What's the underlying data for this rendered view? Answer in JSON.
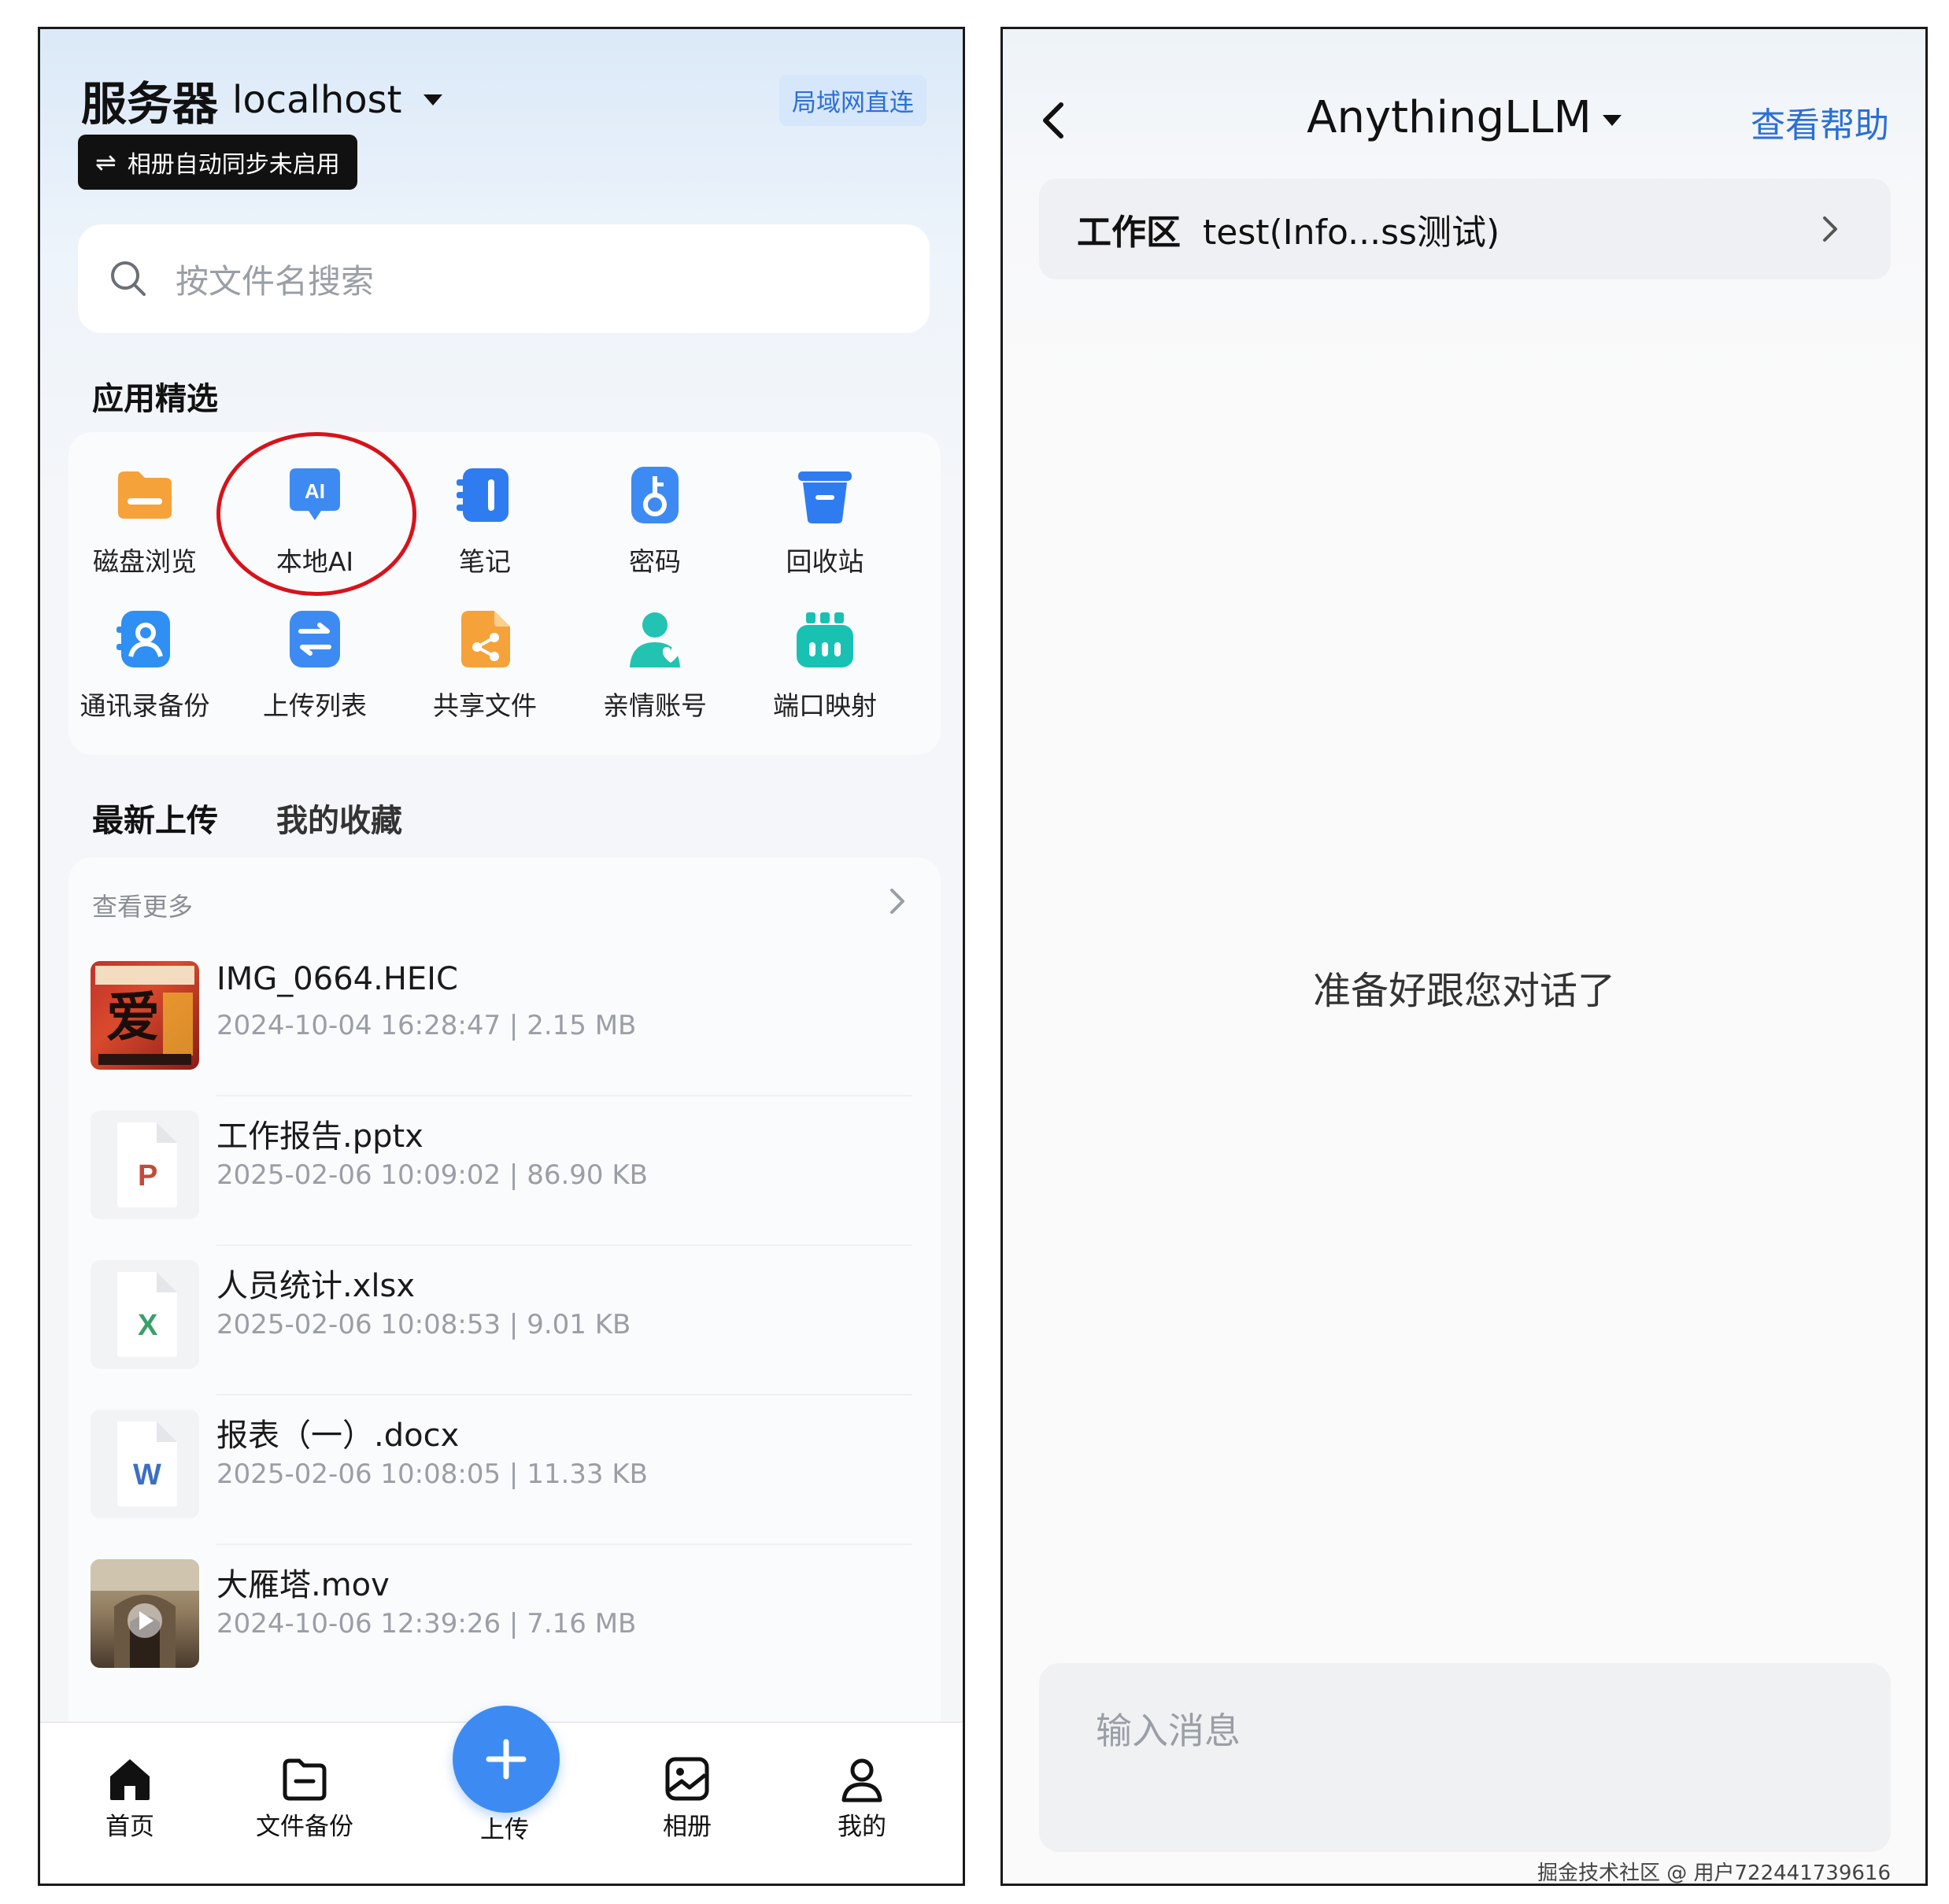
{
  "left": {
    "server_label": "服务器",
    "server_host": "localhost",
    "lan_badge": "局域网直连",
    "sync_icon": "⇌",
    "sync_text": "相册自动同步未启用",
    "search_placeholder": "按文件名搜索",
    "featured_title": "应用精选",
    "apps": [
      {
        "label": "磁盘浏览",
        "icon": "folder-icon",
        "color": "#f6a23a"
      },
      {
        "label": "本地AI",
        "icon": "ai-chat-icon",
        "color": "#3d8bf2"
      },
      {
        "label": "笔记",
        "icon": "notebook-icon",
        "color": "#2f7cf0"
      },
      {
        "label": "密码",
        "icon": "key-icon",
        "color": "#3d8bf2"
      },
      {
        "label": "回收站",
        "icon": "trash-icon",
        "color": "#2f7cf0"
      },
      {
        "label": "通讯录备份",
        "icon": "contacts-icon",
        "color": "#2f8ff2"
      },
      {
        "label": "上传列表",
        "icon": "transfer-icon",
        "color": "#3d8bf2"
      },
      {
        "label": "共享文件",
        "icon": "share-file-icon",
        "color": "#f6a23a"
      },
      {
        "label": "亲情账号",
        "icon": "family-account-icon",
        "color": "#22c3b0"
      },
      {
        "label": "端口映射",
        "icon": "port-mapping-icon",
        "color": "#19c1b3"
      }
    ],
    "highlight_color": "#d8121b",
    "tabs": [
      "最新上传",
      "我的收藏"
    ],
    "see_more": "查看更多",
    "files": [
      {
        "name": "IMG_0664.HEIC",
        "date": "2024-10-04 16:28:47",
        "size": "2.15 MB",
        "type": "image"
      },
      {
        "name": "工作报告.pptx",
        "date": "2025-02-06 10:09:02",
        "size": "86.90 KB",
        "type": "ppt",
        "letter": "P",
        "color": "#c44a3a"
      },
      {
        "name": "人员统计.xlsx",
        "date": "2025-02-06 10:08:53",
        "size": "9.01 KB",
        "type": "xls",
        "letter": "X",
        "color": "#3aa06a"
      },
      {
        "name": "报表（一）.docx",
        "date": "2025-02-06 10:08:05",
        "size": "11.33 KB",
        "type": "doc",
        "letter": "W",
        "color": "#3c6fc4"
      },
      {
        "name": "大雁塔.mov",
        "date": "2024-10-06 12:39:26",
        "size": "7.16 MB",
        "type": "video"
      }
    ],
    "separator": "|",
    "nav": {
      "home": "首页",
      "backup": "文件备份",
      "upload": "上传",
      "album": "相册",
      "me": "我的"
    },
    "accent": "#3d8bf2"
  },
  "right": {
    "title": "AnythingLLM",
    "help": "查看帮助",
    "workspace_label": "工作区",
    "workspace_value": "test(Info...ss测试)",
    "ready": "准备好跟您对话了",
    "input_placeholder": "输入消息",
    "watermark": "掘金技术社区 @ 用户722441739616",
    "link_color": "#2b6fd6"
  }
}
